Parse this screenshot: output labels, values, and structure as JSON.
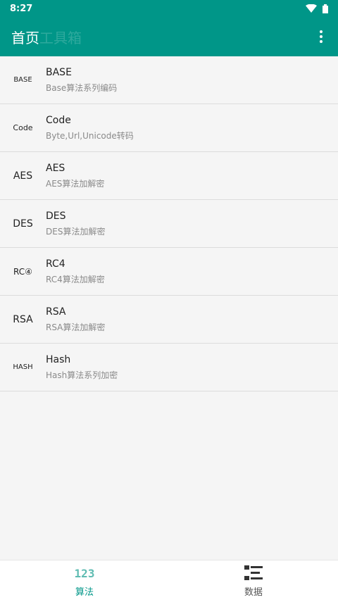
{
  "status_bar": {
    "time": "8:27"
  },
  "app_bar": {
    "title": "首页",
    "faded_title": "工具箱"
  },
  "list": [
    {
      "icon_text": "BASE",
      "name": "BASE",
      "desc": "Base算法系列编码"
    },
    {
      "icon_text": "Code",
      "name": "Code",
      "desc": "Byte,Url,Unicode转码"
    },
    {
      "icon_text": "AES",
      "name": "AES",
      "desc": "AES算法加解密"
    },
    {
      "icon_text": "DES",
      "name": "DES",
      "desc": "DES算法加解密"
    },
    {
      "icon_text": "RC④",
      "name": "RC4",
      "desc": "RC4算法加解密"
    },
    {
      "icon_text": "RSA",
      "name": "RSA",
      "desc": "RSA算法加解密"
    },
    {
      "icon_text": "HASH",
      "name": "Hash",
      "desc": "Hash算法系列加密"
    }
  ],
  "bottom_nav": [
    {
      "icon_text": "123",
      "label": "算法",
      "active": true
    },
    {
      "icon": "list-icon",
      "label": "数据",
      "active": false
    }
  ],
  "colors": {
    "primary": "#009688",
    "accent": "#5fbcb2"
  }
}
